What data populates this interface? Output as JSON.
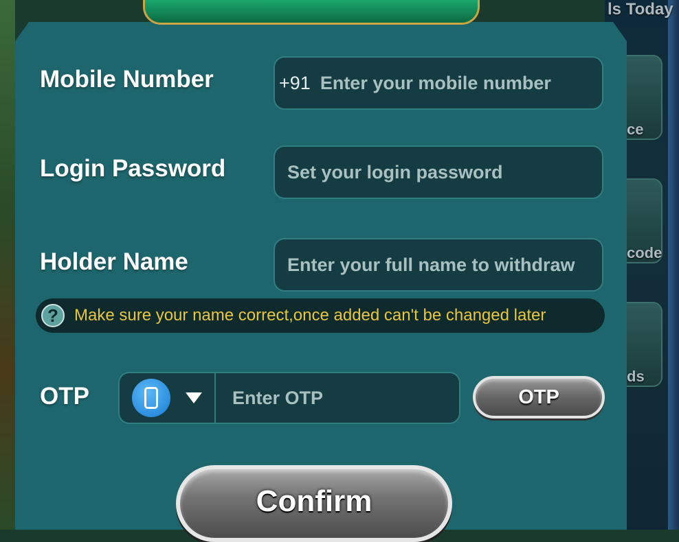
{
  "background": {
    "top_right_text": "ls Today",
    "side_labels": [
      "ce",
      "code",
      "ds"
    ]
  },
  "form": {
    "mobile": {
      "label": "Mobile Number",
      "prefix": "+91",
      "placeholder": "Enter your mobile number"
    },
    "password": {
      "label": "Login Password",
      "placeholder": "Set your login password"
    },
    "holder": {
      "label": "Holder Name",
      "placeholder": "Enter your full name to withdraw"
    },
    "note": {
      "icon": "question-icon",
      "text": "Make sure your name correct,once added can't be changed later"
    },
    "otp": {
      "label": "OTP",
      "method_icon": "phone-icon",
      "placeholder": "Enter OTP",
      "button_label": "OTP"
    },
    "confirm_label": "Confirm"
  },
  "colors": {
    "panel": "#1e666d",
    "field": "#143c42",
    "note_text": "#e8c640"
  }
}
